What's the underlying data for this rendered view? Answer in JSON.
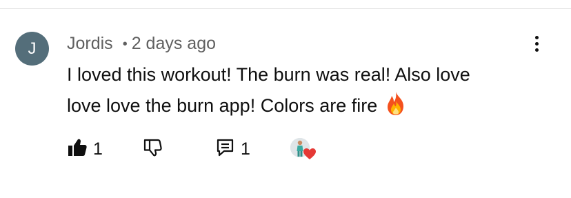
{
  "comment": {
    "avatar_letter": "J",
    "author": "Jordis",
    "separator": "•",
    "timestamp": "2 days ago",
    "text": "I loved this workout! The burn was real! Also love love love the burn app! Colors are fire",
    "emoji_icon": "fire-icon"
  },
  "actions": {
    "like_icon": "thumb-up-filled-icon",
    "like_count": "1",
    "dislike_icon": "thumb-down-icon",
    "reply_icon": "reply-icon",
    "reply_count": "1",
    "creator_heart_icon": "creator-heart-icon",
    "menu_icon": "more-vert-icon"
  },
  "colors": {
    "avatar_bg": "#546e7a",
    "meta_text": "#606060",
    "heart": "#e53935"
  }
}
